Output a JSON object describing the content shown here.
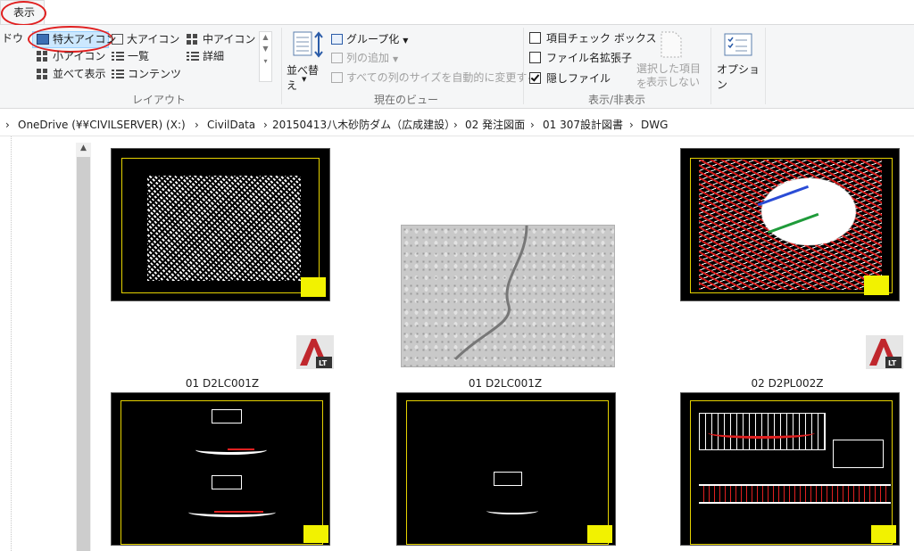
{
  "tabs": {
    "active": "表示",
    "left_clipped": "ドウ"
  },
  "ribbon": {
    "layout": {
      "label": "レイアウト",
      "items": [
        "特大アイコン",
        "大アイコン",
        "中アイコン",
        "小アイコン",
        "一覧",
        "詳細",
        "並べて表示",
        "コンテンツ"
      ],
      "selected": "特大アイコン"
    },
    "current_view": {
      "label": "現在のビュー",
      "sort_button": "並べ替え",
      "group_by": "グループ化",
      "add_column": "列の追加",
      "fit_columns": "すべての列のサイズを自動的に変更する"
    },
    "show_hide": {
      "label": "表示/非表示",
      "checkboxes": [
        {
          "label": "項目チェック ボックス",
          "checked": false
        },
        {
          "label": "ファイル名拡張子",
          "checked": false
        },
        {
          "label": "隠しファイル",
          "checked": true
        }
      ],
      "hide_selected": [
        "選択した項目を",
        "表示しない"
      ]
    },
    "options": {
      "label": "オプション"
    }
  },
  "breadcrumb": {
    "separator": "›",
    "parts": [
      "OneDrive (¥¥CIVILSERVER) (X:)",
      "CivilData",
      "20150413八木砂防ダム（広成建設）",
      "02 発注図面",
      "01 307設計図書",
      "DWG"
    ]
  },
  "files": [
    {
      "name": "01 D2LC001Z",
      "kind": "dwg",
      "badge": "LT"
    },
    {
      "name": "01 D2LC001Z",
      "kind": "image"
    },
    {
      "name": "02 D2PL002Z",
      "kind": "dwg",
      "badge": "LT"
    },
    {
      "name": "",
      "kind": "dwg"
    },
    {
      "name": "",
      "kind": "dwg"
    },
    {
      "name": "",
      "kind": "dwg"
    }
  ],
  "colors": {
    "accent_select": "#cce8ff",
    "annotation": "#e02020",
    "cad_frame": "#e6d300"
  }
}
